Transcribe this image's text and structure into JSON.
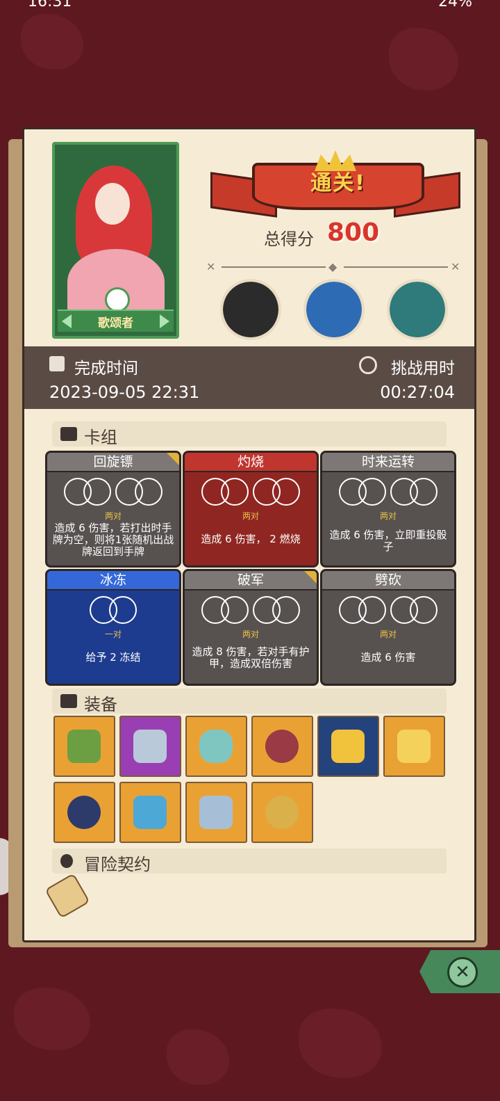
{
  "status_bar": {
    "time": "16:31",
    "battery": "24%"
  },
  "character": {
    "name": "歌颂者"
  },
  "result": {
    "banner": "通关!",
    "score_label": "总得分",
    "score_value": "800"
  },
  "bosses": [
    {
      "name_icon": "witch-boss-icon"
    },
    {
      "name_icon": "spider-king-boss-icon"
    },
    {
      "name_icon": "bird-boss-icon"
    }
  ],
  "times": {
    "finish_label": "完成时间",
    "finish_value": "2023-09-05 22:31",
    "challenge_label": "挑战用时",
    "challenge_value": "00:27:04"
  },
  "deck": {
    "title": "卡组",
    "cards": [
      {
        "name": "回旋镖",
        "dice": "两对",
        "desc": "造成 6 伤害，若打出时手牌为空，则将1张随机出战牌返回到手牌",
        "color": "gray"
      },
      {
        "name": "灼烧",
        "dice": "两对",
        "desc": "造成 6 伤害， 2 燃烧",
        "color": "red"
      },
      {
        "name": "时来运转",
        "dice": "两对",
        "desc": "造成 6 伤害，立即重投骰子",
        "color": "gray"
      },
      {
        "name": "冰冻",
        "dice": "一对",
        "desc": "给予 2 冻结",
        "color": "blue"
      },
      {
        "name": "破军",
        "dice": "两对",
        "desc": "造成 8 伤害，若对手有护甲，造成双倍伤害",
        "color": "gray"
      },
      {
        "name": "劈砍",
        "dice": "两对",
        "desc": "造成 6 伤害",
        "color": "gray"
      }
    ]
  },
  "equipment": {
    "title": "装备",
    "items": [
      "spellbook-icon",
      "dagger-icon",
      "vase-icon",
      "heart-icon",
      "dice-box-icon",
      "crown-icon",
      "plague-mask-icon",
      "shield-icon",
      "saw-blade-icon",
      "lion-ring-icon"
    ]
  },
  "contract": {
    "title": "冒险契约"
  },
  "colors": {
    "background": "#5e1820",
    "panel": "#f6ecd6",
    "accent": "#d9352b"
  }
}
